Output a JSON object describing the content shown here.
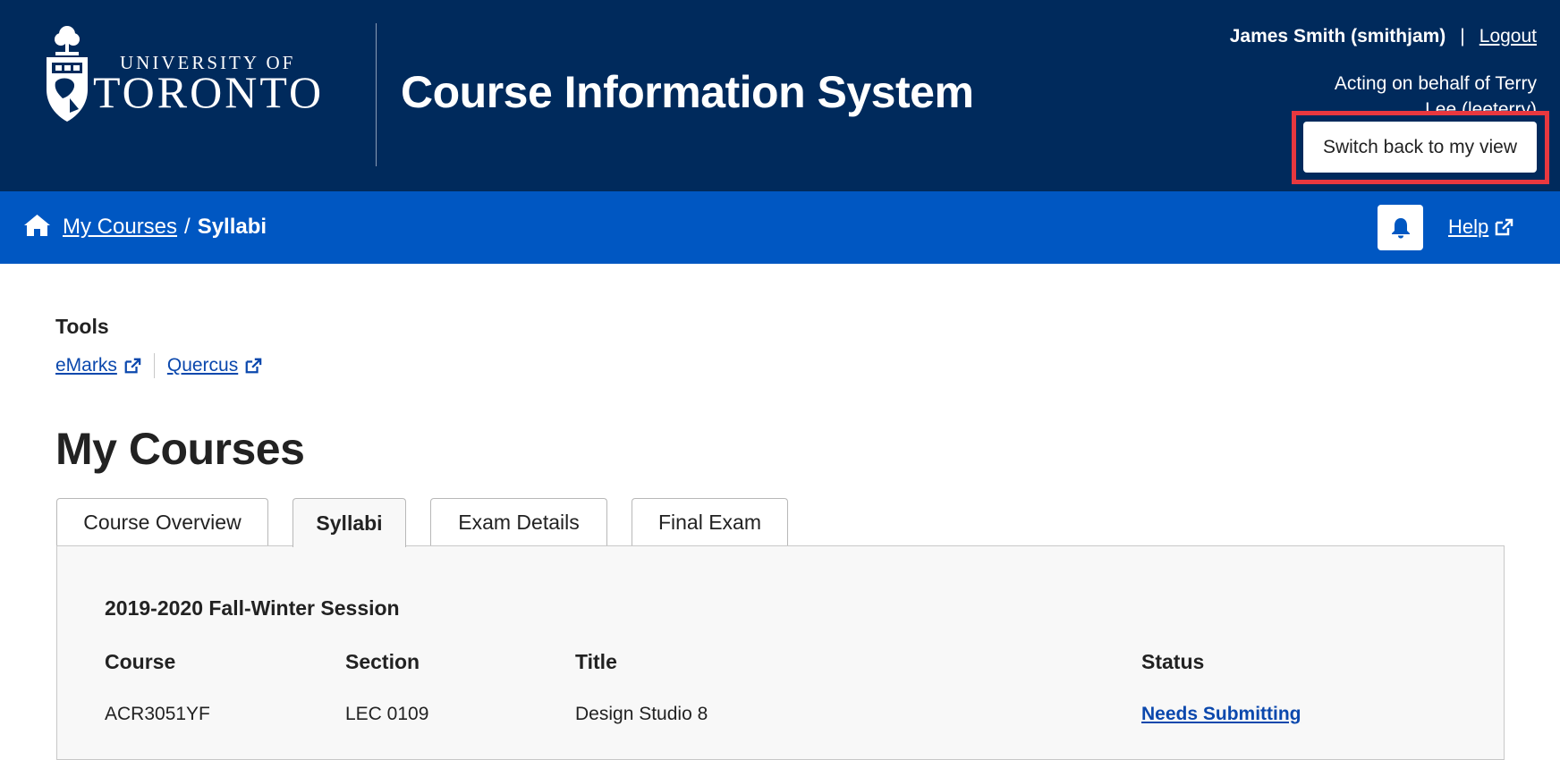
{
  "header": {
    "logo": {
      "line1": "UNIVERSITY OF",
      "line2": "TORONTO"
    },
    "app_title": "Course Information System",
    "user": {
      "name": "James Smith (smithjam)",
      "separator": "|",
      "logout_label": "Logout"
    },
    "acting_text": "Acting on behalf of Terry Lee (leeterry)",
    "switch_back_label": "Switch back to my view",
    "highlight_color": "#e8383f"
  },
  "nav": {
    "breadcrumb": {
      "home_icon": "home-icon",
      "link_label": "My Courses",
      "separator": "/",
      "current": "Syllabi"
    },
    "bell_icon": "bell-icon",
    "help_label": "Help"
  },
  "tools": {
    "heading": "Tools",
    "links": [
      {
        "label": "eMarks"
      },
      {
        "label": "Quercus"
      }
    ]
  },
  "main": {
    "title": "My Courses",
    "tabs": [
      {
        "label": "Course Overview",
        "active": false
      },
      {
        "label": "Syllabi",
        "active": true
      },
      {
        "label": "Exam Details",
        "active": false
      },
      {
        "label": "Final Exam",
        "active": false
      }
    ],
    "session": "2019-2020 Fall-Winter Session",
    "table": {
      "headers": [
        "Course",
        "Section",
        "Title",
        "Status"
      ],
      "rows": [
        [
          "ACR3051YF",
          "LEC 0109",
          "Design Studio 8",
          "Needs Submitting"
        ]
      ]
    }
  },
  "colors": {
    "header_bg": "#002a5c",
    "nav_bg": "#0057c2",
    "link": "#0b48ad"
  }
}
